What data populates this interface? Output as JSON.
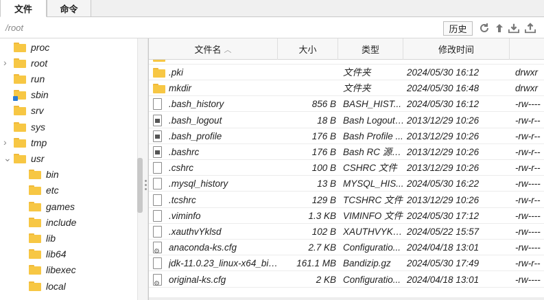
{
  "tabs": [
    {
      "label": "文件",
      "active": true
    },
    {
      "label": "命令",
      "active": false
    }
  ],
  "path": "/root",
  "toolbar": {
    "history_label": "历史",
    "icons": [
      "refresh-icon",
      "up-arrow-icon",
      "download-icon",
      "upload-icon"
    ]
  },
  "tree": [
    {
      "name": "proc",
      "level": 1,
      "expanded": false,
      "arrow": false
    },
    {
      "name": "root",
      "level": 1,
      "expanded": false,
      "arrow": true
    },
    {
      "name": "run",
      "level": 1,
      "expanded": false,
      "arrow": false
    },
    {
      "name": "sbin",
      "level": 1,
      "expanded": false,
      "arrow": false,
      "link": true
    },
    {
      "name": "srv",
      "level": 1,
      "expanded": false,
      "arrow": false
    },
    {
      "name": "sys",
      "level": 1,
      "expanded": false,
      "arrow": false
    },
    {
      "name": "tmp",
      "level": 1,
      "expanded": false,
      "arrow": true
    },
    {
      "name": "usr",
      "level": 1,
      "expanded": true,
      "arrow": true
    },
    {
      "name": "bin",
      "level": 2
    },
    {
      "name": "etc",
      "level": 2
    },
    {
      "name": "games",
      "level": 2
    },
    {
      "name": "include",
      "level": 2
    },
    {
      "name": "lib",
      "level": 2
    },
    {
      "name": "lib64",
      "level": 2
    },
    {
      "name": "libexec",
      "level": 2
    },
    {
      "name": "local",
      "level": 2
    }
  ],
  "columns": {
    "name": "文件名",
    "size": "大小",
    "type": "类型",
    "time": "修改时间"
  },
  "files": [
    {
      "icon": "folder",
      "name": ".pki",
      "size": "",
      "type": "文件夹",
      "time": "2024/05/30 16:12",
      "perm": "drwxr"
    },
    {
      "icon": "folder",
      "name": "mkdir",
      "size": "",
      "type": "文件夹",
      "time": "2024/05/30 16:48",
      "perm": "drwxr"
    },
    {
      "icon": "file",
      "name": ".bash_history",
      "size": "856 B",
      "type": "BASH_HIST...",
      "time": "2024/05/30 16:12",
      "perm": "-rw----"
    },
    {
      "icon": "exec",
      "name": ".bash_logout",
      "size": "18 B",
      "type": "Bash Logout ...",
      "time": "2013/12/29 10:26",
      "perm": "-rw-r--"
    },
    {
      "icon": "exec",
      "name": ".bash_profile",
      "size": "176 B",
      "type": "Bash Profile ...",
      "time": "2013/12/29 10:26",
      "perm": "-rw-r--"
    },
    {
      "icon": "exec",
      "name": ".bashrc",
      "size": "176 B",
      "type": "Bash RC 源文件",
      "time": "2013/12/29 10:26",
      "perm": "-rw-r--"
    },
    {
      "icon": "file",
      "name": ".cshrc",
      "size": "100 B",
      "type": "CSHRC 文件",
      "time": "2013/12/29 10:26",
      "perm": "-rw-r--"
    },
    {
      "icon": "file",
      "name": ".mysql_history",
      "size": "13 B",
      "type": "MYSQL_HIS...",
      "time": "2024/05/30 16:22",
      "perm": "-rw----"
    },
    {
      "icon": "file",
      "name": ".tcshrc",
      "size": "129 B",
      "type": "TCSHRC 文件",
      "time": "2013/12/29 10:26",
      "perm": "-rw-r--"
    },
    {
      "icon": "file",
      "name": ".viminfo",
      "size": "1.3 KB",
      "type": "VIMINFO 文件",
      "time": "2024/05/30 17:12",
      "perm": "-rw----"
    },
    {
      "icon": "file",
      "name": ".xauthvYklsd",
      "size": "102 B",
      "type": "XAUTHVYKLS...",
      "time": "2024/05/22 15:57",
      "perm": "-rw----"
    },
    {
      "icon": "cfg",
      "name": "anaconda-ks.cfg",
      "size": "2.7 KB",
      "type": "Configuratio...",
      "time": "2024/04/18 13:01",
      "perm": "-rw----"
    },
    {
      "icon": "file",
      "name": "jdk-11.0.23_linux-x64_bin....",
      "size": "161.1 MB",
      "type": "Bandizip.gz",
      "time": "2024/05/30 17:49",
      "perm": "-rw-r--"
    },
    {
      "icon": "cfg",
      "name": "original-ks.cfg",
      "size": "2 KB",
      "type": "Configuratio...",
      "time": "2024/04/18 13:01",
      "perm": "-rw----"
    }
  ]
}
